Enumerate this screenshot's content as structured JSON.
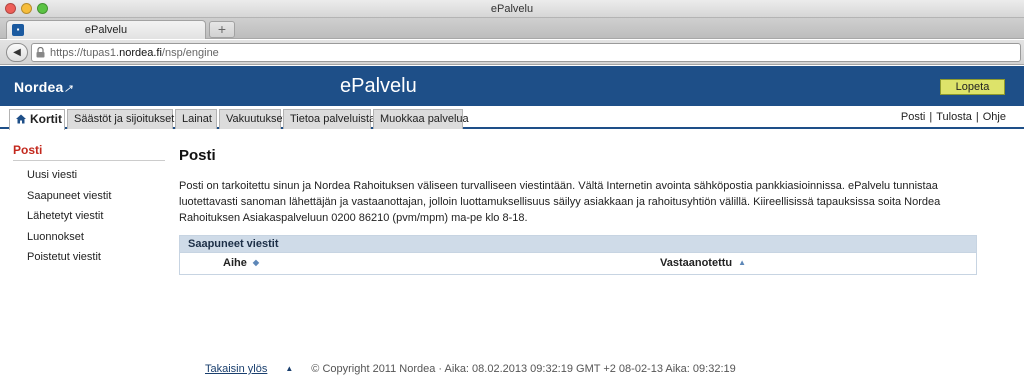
{
  "window": {
    "title": "ePalvelu"
  },
  "browser": {
    "tab_label": "ePalvelu",
    "newtab_label": "+",
    "url_prefix": "https://tupas1.",
    "url_domain": "nordea.fi",
    "url_path": "/nsp/engine",
    "icons": {
      "back": "back-arrow-icon",
      "lock": "lock-icon",
      "favicon": "nordea-favicon-icon"
    }
  },
  "header": {
    "logo": "Nordea",
    "title": "ePalvelu",
    "logout_label": "Lopeta",
    "colors": {
      "brand": "#1e4f88",
      "logout": "#dde36a"
    }
  },
  "menu": {
    "tabs": [
      {
        "label": "Kortit",
        "icon": "home-icon"
      },
      {
        "label": "Säästöt ja sijoitukset"
      },
      {
        "label": "Lainat"
      },
      {
        "label": "Vakuutukset"
      },
      {
        "label": "Tietoa palveluista"
      },
      {
        "label": "Muokkaa palvelua"
      }
    ],
    "utils": [
      "Posti",
      "Tulosta",
      "Ohje"
    ]
  },
  "sidebar": {
    "heading": "Posti",
    "items": [
      "Uusi viesti",
      "Saapuneet viestit",
      "Lähetetyt viestit",
      "Luonnokset",
      "Poistetut viestit"
    ]
  },
  "main": {
    "title": "Posti",
    "intro": "Posti on tarkoitettu sinun ja Nordea Rahoituksen väliseen turvalliseen viestintään. Vältä Internetin avointa sähköpostia pankkiasioinnissa. ePalvelu tunnistaa luotettavasti sanoman lähettäjän ja vastaanottajan, jolloin luottamuksellisuus säilyy asiakkaan ja rahoitusyhtiön välillä. Kiireellisissä tapauksissa soita Nordea Rahoituksen Asiakaspalveluun 0200 86210 (pvm/mpm) ma-pe klo 8-18.",
    "inbox": {
      "heading": "Saapuneet viestit",
      "columns": [
        "Aihe",
        "Vastaanotettu"
      ]
    }
  },
  "footer": {
    "top_link": "Takaisin ylös",
    "copyright": "© Copyright 2011 Nordea · Aika: 08.02.2013 09:32:19 GMT +2 08-02-13 Aika: 09:32:19"
  }
}
